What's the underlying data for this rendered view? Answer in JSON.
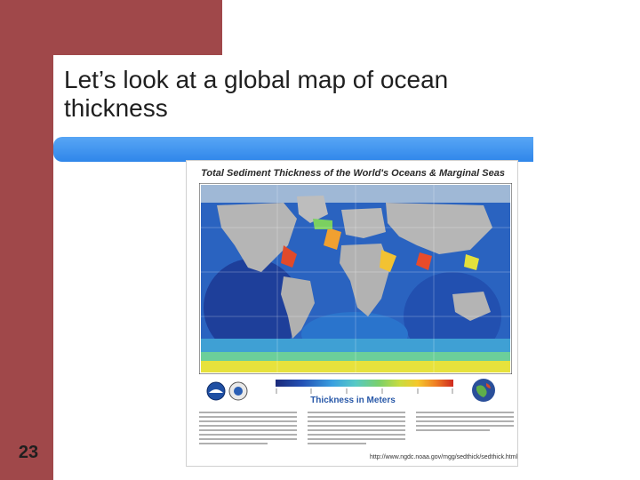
{
  "slide": {
    "title": "Let’s look at a global map of ocean thickness",
    "number": "23",
    "colors": {
      "accent": "#a0484a",
      "rule": "#2f86ea"
    }
  },
  "figure": {
    "title": "Total Sediment Thickness of the World's Oceans & Marginal Seas",
    "legend_label": "Thickness in Meters",
    "url": "http://www.ngdc.noaa.gov/mgg/sedthick/sedthick.html",
    "icons": [
      "noaa-logo-icon",
      "ngdc-logo-icon",
      "globe-icon"
    ]
  }
}
